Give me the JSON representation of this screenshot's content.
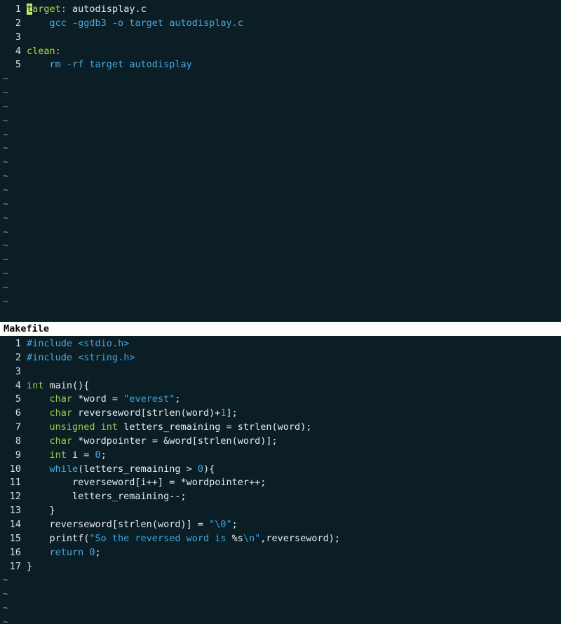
{
  "colors": {
    "background": "#0b1e25",
    "keyword": "#49a9de",
    "type": "#9ccc4b",
    "label": "#b7d54a",
    "status_bar": "#ffffff"
  },
  "top_pane": {
    "filename": "Makefile",
    "lines": [
      {
        "n": "1",
        "tokens": [
          {
            "t": "t",
            "c": "cursor"
          },
          {
            "t": "arget:",
            "c": "label"
          },
          {
            "t": " autodisplay.c",
            "c": "plain"
          }
        ]
      },
      {
        "n": "2",
        "tokens": [
          {
            "t": "    gcc -ggdb3 -o target autodisplay.c",
            "c": "blue"
          }
        ]
      },
      {
        "n": "3",
        "tokens": []
      },
      {
        "n": "4",
        "tokens": [
          {
            "t": "clean:",
            "c": "label"
          }
        ]
      },
      {
        "n": "5",
        "tokens": [
          {
            "t": "    rm -rf target autodisplay",
            "c": "blue"
          }
        ]
      }
    ],
    "tilde_count": 17
  },
  "status_bar": {
    "text": "Makefile"
  },
  "bottom_pane": {
    "lines": [
      {
        "n": "1",
        "tokens": [
          {
            "t": "#include",
            "c": "blue"
          },
          {
            "t": " ",
            "c": "plain"
          },
          {
            "t": "<stdio.h>",
            "c": "str"
          }
        ]
      },
      {
        "n": "2",
        "tokens": [
          {
            "t": "#include",
            "c": "blue"
          },
          {
            "t": " ",
            "c": "plain"
          },
          {
            "t": "<string.h>",
            "c": "str"
          }
        ]
      },
      {
        "n": "3",
        "tokens": []
      },
      {
        "n": "4",
        "tokens": [
          {
            "t": "int",
            "c": "green"
          },
          {
            "t": " main(){",
            "c": "plain"
          }
        ]
      },
      {
        "n": "5",
        "tokens": [
          {
            "t": "    ",
            "c": "plain"
          },
          {
            "t": "char",
            "c": "green"
          },
          {
            "t": " *word = ",
            "c": "plain"
          },
          {
            "t": "\"everest\"",
            "c": "str"
          },
          {
            "t": ";",
            "c": "plain"
          }
        ]
      },
      {
        "n": "6",
        "tokens": [
          {
            "t": "    ",
            "c": "plain"
          },
          {
            "t": "char",
            "c": "green"
          },
          {
            "t": " reverseword[strlen(word)+",
            "c": "plain"
          },
          {
            "t": "1",
            "c": "num"
          },
          {
            "t": "];",
            "c": "plain"
          }
        ]
      },
      {
        "n": "7",
        "tokens": [
          {
            "t": "    ",
            "c": "plain"
          },
          {
            "t": "unsigned int",
            "c": "green"
          },
          {
            "t": " letters_remaining = strlen(word);",
            "c": "plain"
          }
        ]
      },
      {
        "n": "8",
        "tokens": [
          {
            "t": "    ",
            "c": "plain"
          },
          {
            "t": "char",
            "c": "green"
          },
          {
            "t": " *wordpointer = &word[strlen(word)];",
            "c": "plain"
          }
        ]
      },
      {
        "n": "9",
        "tokens": [
          {
            "t": "    ",
            "c": "plain"
          },
          {
            "t": "int",
            "c": "green"
          },
          {
            "t": " i = ",
            "c": "plain"
          },
          {
            "t": "0",
            "c": "num"
          },
          {
            "t": ";",
            "c": "plain"
          }
        ]
      },
      {
        "n": "10",
        "tokens": [
          {
            "t": "    ",
            "c": "plain"
          },
          {
            "t": "while",
            "c": "blue"
          },
          {
            "t": "(letters_remaining > ",
            "c": "plain"
          },
          {
            "t": "0",
            "c": "num"
          },
          {
            "t": "){",
            "c": "plain"
          }
        ]
      },
      {
        "n": "11",
        "tokens": [
          {
            "t": "        reverseword[i++] = *wordpointer++;",
            "c": "plain"
          }
        ]
      },
      {
        "n": "12",
        "tokens": [
          {
            "t": "        letters_remaining--;",
            "c": "plain"
          }
        ]
      },
      {
        "n": "13",
        "tokens": [
          {
            "t": "    }",
            "c": "plain"
          }
        ]
      },
      {
        "n": "14",
        "tokens": [
          {
            "t": "    reverseword[strlen(word)] = ",
            "c": "plain"
          },
          {
            "t": "\"\\0\"",
            "c": "str"
          },
          {
            "t": ";",
            "c": "plain"
          }
        ]
      },
      {
        "n": "15",
        "tokens": [
          {
            "t": "    printf(",
            "c": "plain"
          },
          {
            "t": "\"So the reversed word is ",
            "c": "str"
          },
          {
            "t": "%s",
            "c": "plain"
          },
          {
            "t": "\\n\"",
            "c": "str"
          },
          {
            "t": ",reverseword);",
            "c": "plain"
          }
        ]
      },
      {
        "n": "16",
        "tokens": [
          {
            "t": "    ",
            "c": "plain"
          },
          {
            "t": "return",
            "c": "blue"
          },
          {
            "t": " ",
            "c": "plain"
          },
          {
            "t": "0",
            "c": "num"
          },
          {
            "t": ";",
            "c": "plain"
          }
        ]
      },
      {
        "n": "17",
        "tokens": [
          {
            "t": "}",
            "c": "plain"
          }
        ]
      }
    ],
    "tilde_count": 4
  },
  "tilde_char": "~"
}
